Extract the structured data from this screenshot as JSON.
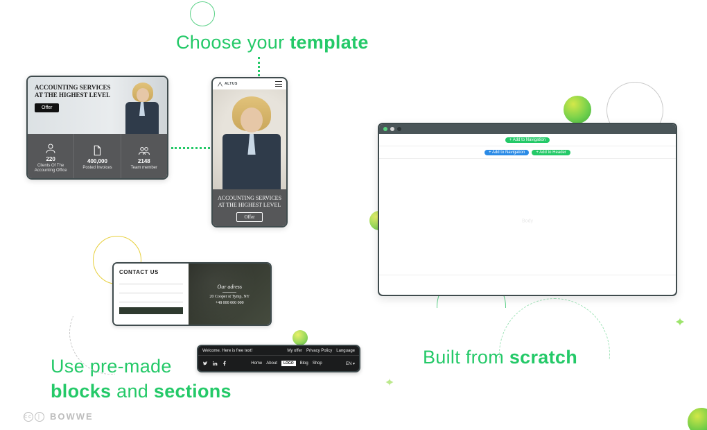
{
  "headings": {
    "template_pre": "Choose your ",
    "template_bold": "template",
    "blocks_pre": "Use pre-made",
    "blocks_bold1": "blocks",
    "blocks_mid": " and ",
    "blocks_bold2": "sections",
    "scratch_pre": "Built from ",
    "scratch_bold": "scratch"
  },
  "desktop_template": {
    "title": "ACCOUNTING SERVICES AT THE HIGHEST LEVEL",
    "offer_btn": "Offer",
    "stats": [
      {
        "num": "220",
        "label": "Clients Of The Accounting Office"
      },
      {
        "num": "400,000",
        "label": "Posted Invoices"
      },
      {
        "num": "2148",
        "label": "Team member"
      }
    ]
  },
  "mobile_template": {
    "logo": "ALTUS",
    "title": "ACCOUNTING SERVICES AT THE HIGHEST LEVEL",
    "offer_btn": "Offer"
  },
  "contact_card": {
    "heading": "CONTACT US",
    "address_title": "Our adress",
    "address_line1": "20 Cooper st Tymp, NY",
    "address_line2": "+48 000 000 000"
  },
  "nav_card": {
    "welcome": "Welcome. Here is free text!",
    "top_links": [
      "My offer",
      "Privacy Policy",
      "Language"
    ],
    "menu": [
      "Home",
      "About",
      "LOGO",
      "Blog",
      "Shop"
    ],
    "lang": "EN ▾"
  },
  "browser": {
    "pill1": "+ Add to Navigation",
    "pill2": "+ Add to Navigation",
    "pill3": "+ Add to Header",
    "faint": "Body"
  },
  "brand": {
    "name": "BOWWE"
  }
}
